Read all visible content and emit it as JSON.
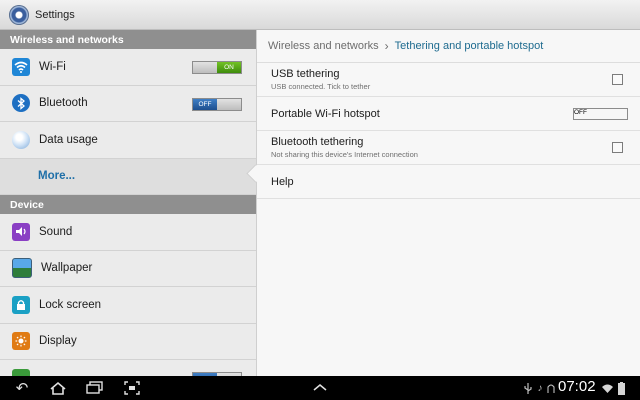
{
  "app": {
    "title": "Settings",
    "icon": "settings-gear-icon"
  },
  "sidebar": {
    "sections": [
      {
        "header": "Wireless and networks",
        "items": [
          {
            "label": "Wi-Fi",
            "icon": "wifi-icon",
            "toggle": "ON"
          },
          {
            "label": "Bluetooth",
            "icon": "bluetooth-icon",
            "toggle": "OFF"
          },
          {
            "label": "Data usage",
            "icon": "data-usage-icon"
          },
          {
            "label": "More..."
          }
        ]
      },
      {
        "header": "Device",
        "items": [
          {
            "label": "Sound",
            "icon": "sound-icon"
          },
          {
            "label": "Wallpaper",
            "icon": "wallpaper-icon"
          },
          {
            "label": "Lock screen",
            "icon": "lock-icon"
          },
          {
            "label": "Display",
            "icon": "display-icon"
          }
        ]
      }
    ]
  },
  "breadcrumb": {
    "parent": "Wireless and networks",
    "separator": "›",
    "current": "Tethering and portable hotspot"
  },
  "prefs": {
    "usb": {
      "title": "USB tethering",
      "summary": "USB connected. Tick to tether",
      "checked": false
    },
    "hotspot": {
      "title": "Portable Wi-Fi hotspot",
      "toggle": "OFF"
    },
    "bt": {
      "title": "Bluetooth tethering",
      "summary": "Not sharing this device's Internet connection",
      "checked": false
    },
    "help": {
      "title": "Help"
    }
  },
  "navbar": {
    "back": "↶",
    "home": "⌂",
    "recent": "▭",
    "screenshot": "⛶",
    "up": "︿",
    "clock": "07:02",
    "status_icons": [
      "usb-icon",
      "music-icon",
      "wifi-signal-icon",
      "battery-icon"
    ]
  },
  "colors": {
    "accent": "#1e6b8f",
    "on": "#4aa11a",
    "off": "#2a62a8"
  }
}
